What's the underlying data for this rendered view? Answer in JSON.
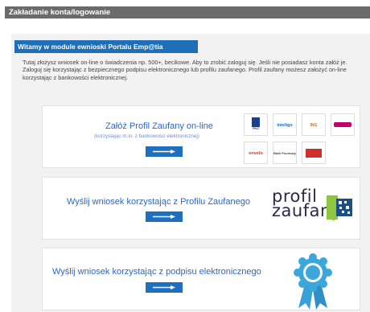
{
  "header": {
    "title": "Zakładanie konta/logowanie"
  },
  "welcome": {
    "title": "Witamy w module ewnioski Portalu Emp@tia"
  },
  "intro": {
    "text": "Tutaj złożysz wniosek on-line o świadczenia np. 500+, becikowe. Aby to zrobić zaloguj się. Jeśli nie posiadasz konta załóż je. Zaloguj się korzystając z bezpiecznego podpisu elektronicznego lub profilu zaufanego. Profil zaufany możesz założyć on-line korzystając z bankowości elektronicznej."
  },
  "options": [
    {
      "title": "Załóż Profil Zaufany on-line",
      "subtitle": "(korzystając m.in. z bankowości elektronicznej)"
    },
    {
      "title": "Wyślij wniosek korzystając z Profilu Zaufanego",
      "logo_text": "profil zaufany"
    },
    {
      "title": "Wyślij wniosek korzystając z podpisu elektronicznego"
    }
  ],
  "banks": [
    {
      "name": "PKO",
      "color": "#1b3f8b"
    },
    {
      "name": "inteligo",
      "color": "#1b6fb5"
    },
    {
      "name": "ING",
      "color": "#ff6200"
    },
    {
      "name": "Millennium",
      "color": "#c3006b"
    },
    {
      "name": "envelo",
      "color": "#e0341e"
    },
    {
      "name": "Bank Pocztowy",
      "color": "#444444"
    },
    {
      "name": "mBank",
      "color": "#d0312d"
    }
  ],
  "colors": {
    "accent": "#1f6eb8",
    "link": "#2c67c8",
    "header_bg": "#6b6b6b"
  }
}
